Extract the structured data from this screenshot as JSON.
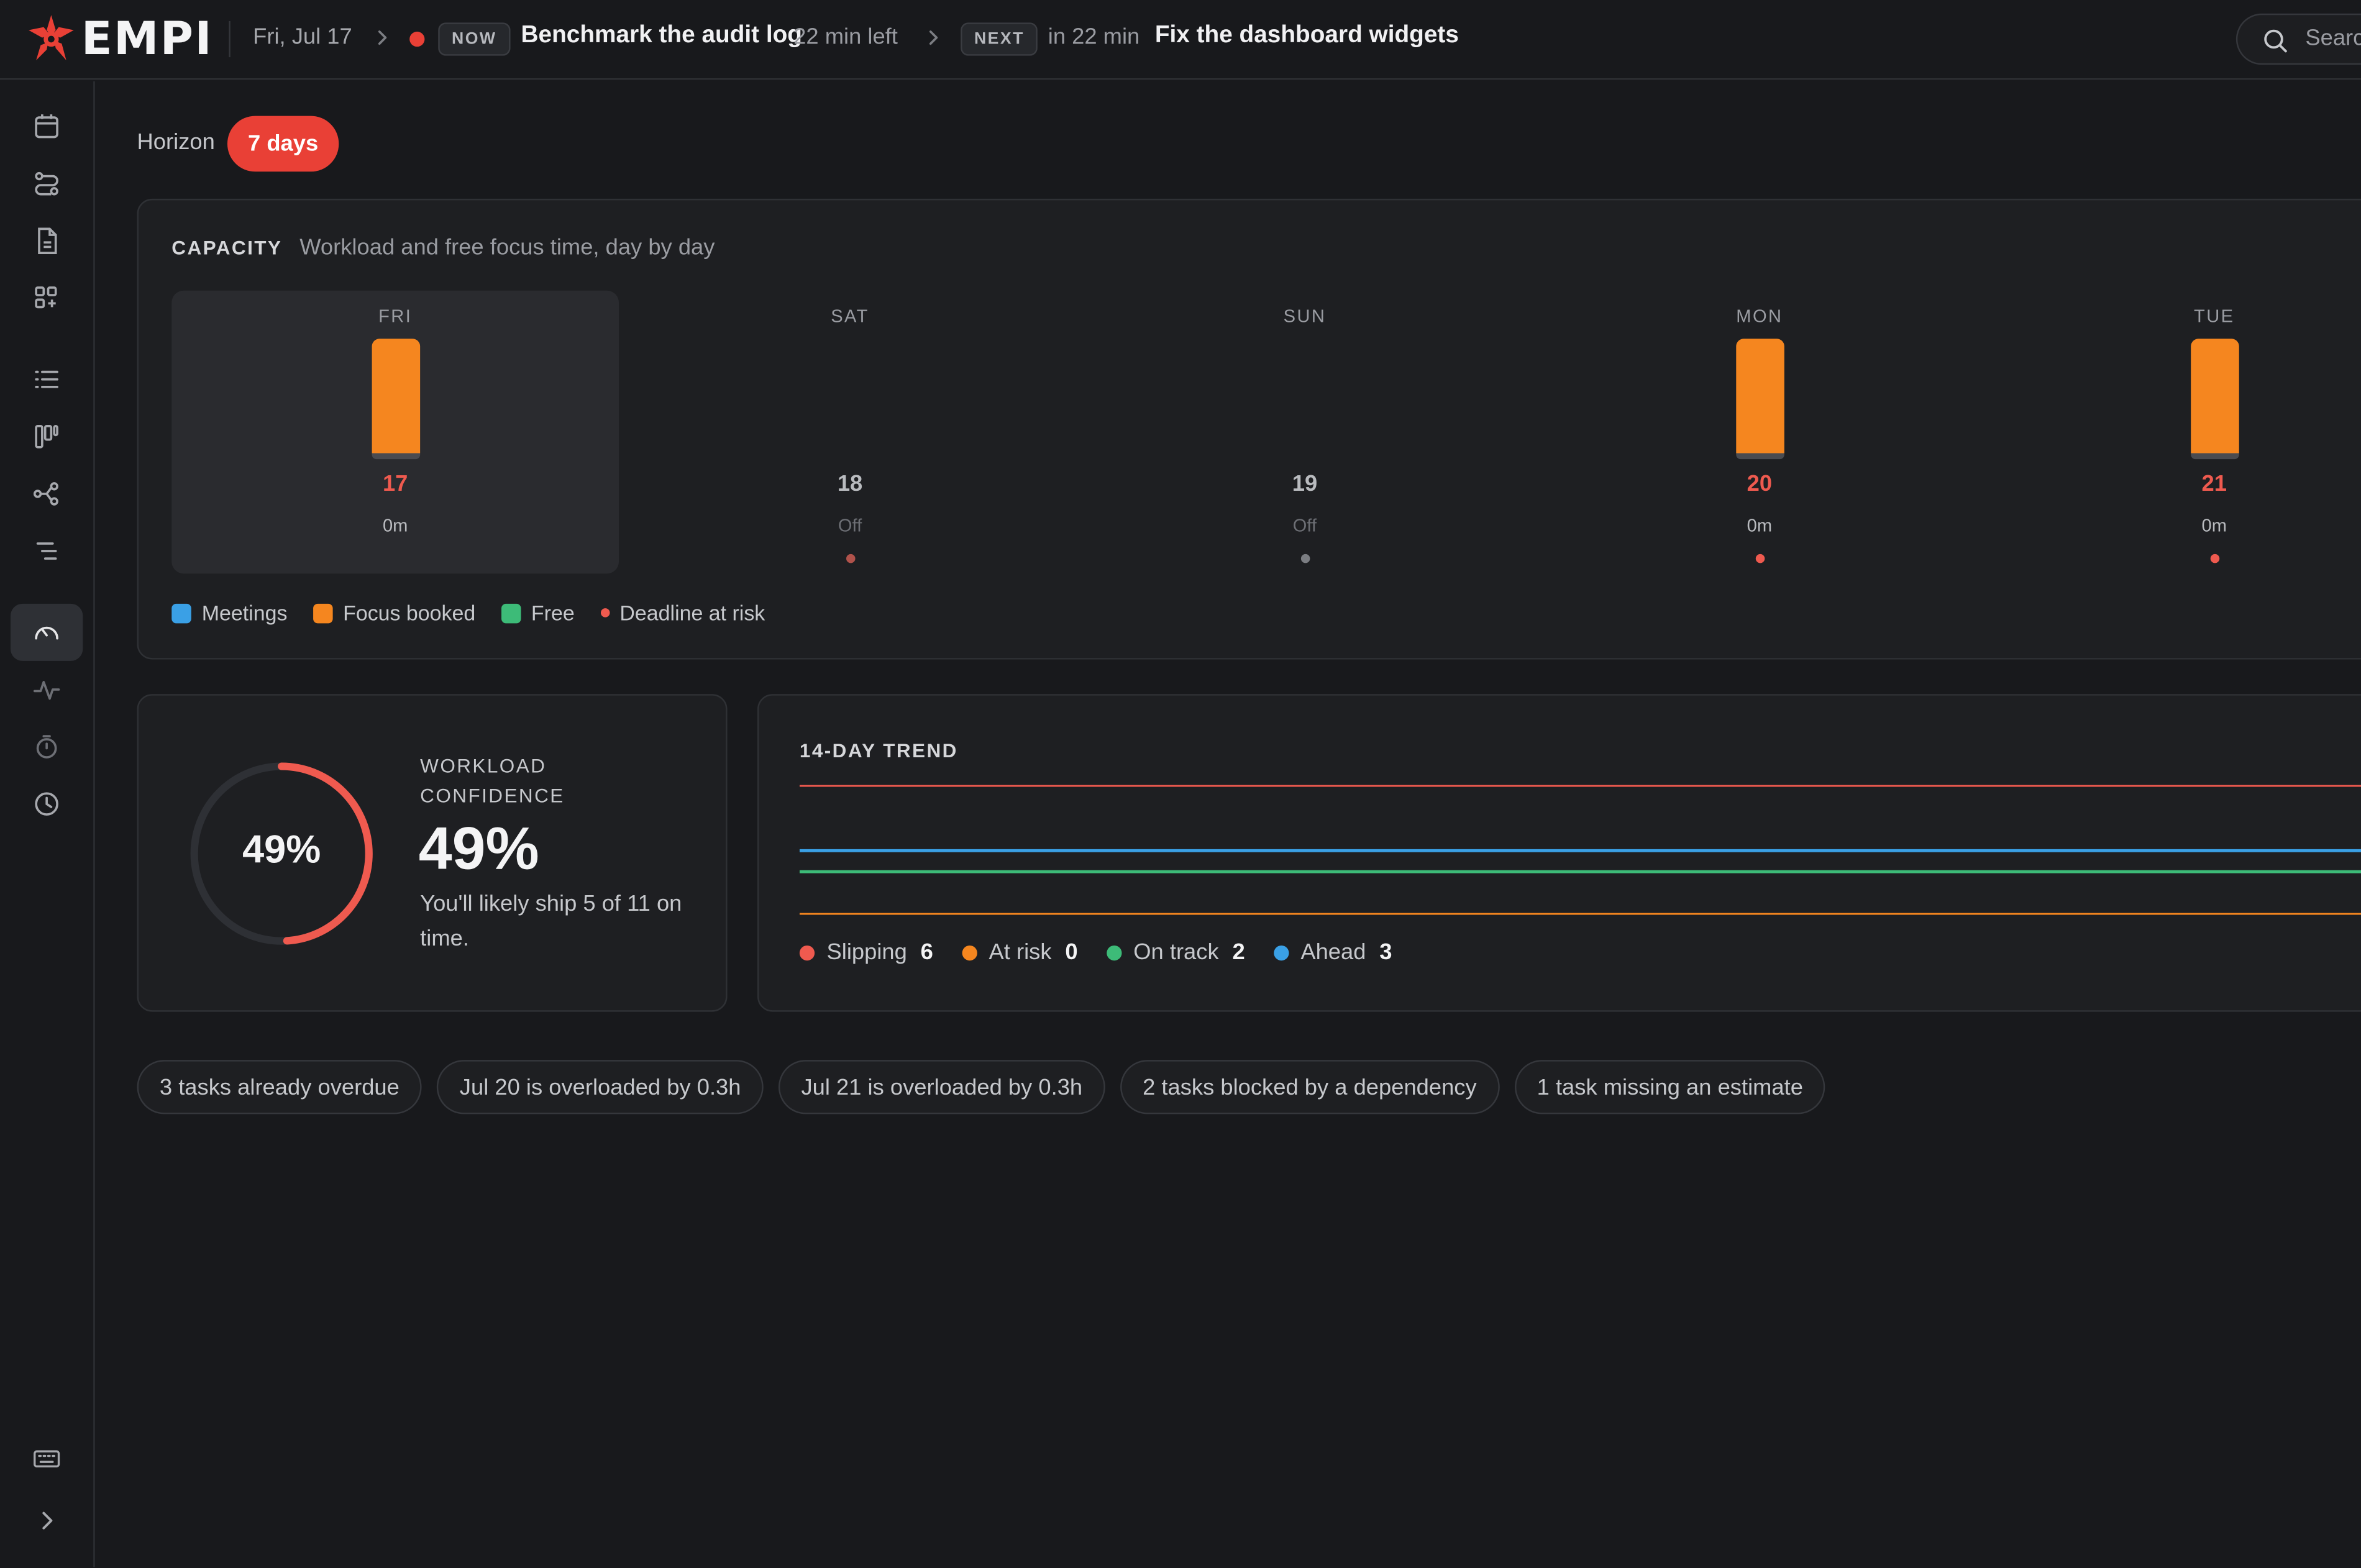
{
  "app": {
    "name": "EMPI"
  },
  "topbar": {
    "date": "Fri, Jul 17",
    "now_badge": "NOW",
    "now_task": "Benchmark the audit log",
    "now_time_left": "22 min left",
    "next_badge": "NEXT",
    "next_in": "in 22 min",
    "next_task": "Fix the dashboard widgets",
    "search_placeholder": "Searc"
  },
  "sidebar": {
    "items": [
      {
        "icon": "calendar-icon"
      },
      {
        "icon": "routes-icon"
      },
      {
        "icon": "document-icon"
      },
      {
        "icon": "apps-add-icon"
      },
      {
        "icon": "list-icon"
      },
      {
        "icon": "kanban-icon"
      },
      {
        "icon": "graph-icon"
      },
      {
        "icon": "indented-list-icon"
      },
      {
        "icon": "gauge-icon",
        "active": true
      },
      {
        "icon": "pulse-icon"
      },
      {
        "icon": "stopwatch-icon"
      },
      {
        "icon": "clock-icon"
      }
    ],
    "bottom": [
      {
        "icon": "keyboard-icon"
      },
      {
        "icon": "chevron-right-icon"
      }
    ]
  },
  "horizon": {
    "label": "Horizon",
    "value": "7 days"
  },
  "capacity": {
    "title": "CAPACITY",
    "subtitle": "Workload and free focus time, day by day",
    "days": [
      {
        "name": "FRI",
        "date": "17",
        "load": "0m",
        "today": true,
        "focus_bar": true,
        "dot": "none",
        "date_color": "red"
      },
      {
        "name": "SAT",
        "date": "18",
        "load": "Off",
        "today": false,
        "focus_bar": false,
        "dot": "red-dim",
        "date_color": "grey"
      },
      {
        "name": "SUN",
        "date": "19",
        "load": "Off",
        "today": false,
        "focus_bar": false,
        "dot": "grey",
        "date_color": "grey"
      },
      {
        "name": "MON",
        "date": "20",
        "load": "0m",
        "today": false,
        "focus_bar": true,
        "dot": "red",
        "date_color": "red"
      },
      {
        "name": "TUE",
        "date": "21",
        "load": "0m",
        "today": false,
        "focus_bar": true,
        "dot": "red",
        "date_color": "red"
      }
    ],
    "legend": [
      {
        "label": "Meetings",
        "color": "#3aa0e6",
        "shape": "square"
      },
      {
        "label": "Focus booked",
        "color": "#f5861f",
        "shape": "square"
      },
      {
        "label": "Free",
        "color": "#3dbb78",
        "shape": "square"
      },
      {
        "label": "Deadline at risk",
        "color": "#ef5a4f",
        "shape": "dot"
      }
    ]
  },
  "confidence": {
    "ring_value": "49%",
    "ring_fraction": 0.49,
    "label": "WORKLOAD CONFIDENCE",
    "big_value": "49%",
    "description": "You'll likely ship 5 of 11 on time."
  },
  "trend": {
    "title": "14-DAY TREND",
    "series": [
      {
        "name": "Slipping",
        "count": "6",
        "color": "#ef5a4f"
      },
      {
        "name": "At risk",
        "count": "0",
        "color": "#f5861f"
      },
      {
        "name": "On track",
        "count": "2",
        "color": "#3dbb78"
      },
      {
        "name": "Ahead",
        "count": "3",
        "color": "#3aa0e6"
      }
    ]
  },
  "chips": [
    "3 tasks already overdue",
    "Jul 20 is overloaded by 0.3h",
    "Jul 21 is overloaded by 0.3h",
    "2 tasks blocked by a dependency",
    "1 task missing an estimate"
  ]
}
